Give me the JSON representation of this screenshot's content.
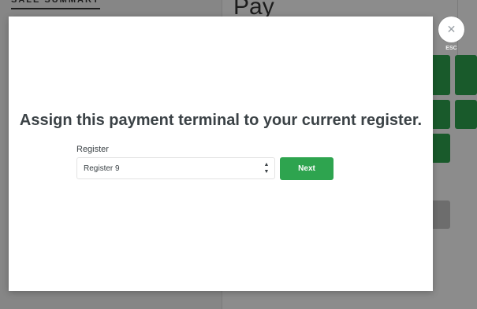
{
  "background": {
    "sale_summary_title": "SALE SUMMARY",
    "pay_title": "Pay",
    "tile_color": "#2ea44f"
  },
  "modal": {
    "title": "Assign this payment terminal to your current register.",
    "register_label": "Register",
    "register_value": "Register 9",
    "next_label": "Next",
    "accent_color": "#2ea44f"
  },
  "close": {
    "icon": "close-icon",
    "esc_label": "ESC"
  }
}
